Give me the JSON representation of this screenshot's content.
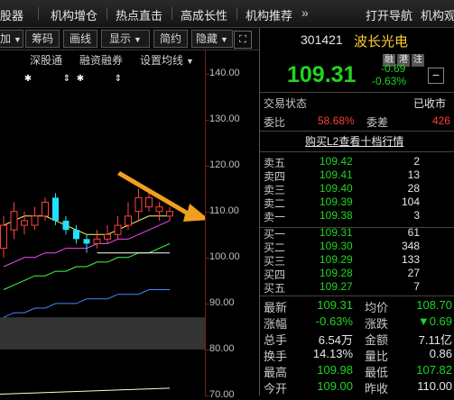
{
  "topbar": {
    "items": [
      "股器",
      "机构增仓",
      "热点直击",
      "高成长性",
      "机构推荐",
      "打开导航",
      "机构观点"
    ],
    "more_icon": "double-chevron-right-icon"
  },
  "toolbar": {
    "buttons": [
      "加",
      "筹码",
      "画线",
      "显示",
      "简约",
      "隐藏"
    ],
    "expand_icon": "expand-icon"
  },
  "chart": {
    "menus": [
      "深股通",
      "融资融券",
      "设置均线"
    ],
    "y_ticks": [
      "140.00",
      "130.00",
      "120.00",
      "110.00",
      "100.00",
      "90.00",
      "80.00",
      "70.00"
    ]
  },
  "chart_data": {
    "type": "candlestick",
    "title": "",
    "y_ticks": [
      140,
      130,
      120,
      110,
      100,
      90,
      80,
      70
    ],
    "ylim": [
      70,
      145
    ],
    "candles": [
      {
        "open": 102,
        "close": 107,
        "high": 109,
        "low": 100,
        "color": "red"
      },
      {
        "open": 106,
        "close": 110,
        "high": 112,
        "low": 104,
        "color": "red"
      },
      {
        "open": 108,
        "close": 107,
        "high": 110,
        "low": 105,
        "color": "red"
      },
      {
        "open": 107,
        "close": 109,
        "high": 111,
        "low": 106,
        "color": "red"
      },
      {
        "open": 109,
        "close": 112,
        "high": 113,
        "low": 108,
        "color": "red"
      },
      {
        "open": 113,
        "close": 108,
        "high": 114,
        "low": 107,
        "color": "cyan"
      },
      {
        "open": 108,
        "close": 106,
        "high": 109,
        "low": 105,
        "color": "cyan"
      },
      {
        "open": 106,
        "close": 104,
        "high": 107,
        "low": 103,
        "color": "cyan"
      },
      {
        "open": 104,
        "close": 103,
        "high": 105,
        "low": 101,
        "color": "cyan"
      },
      {
        "open": 103,
        "close": 104,
        "high": 106,
        "low": 102,
        "color": "red"
      },
      {
        "open": 104,
        "close": 105,
        "high": 107,
        "low": 103,
        "color": "red"
      },
      {
        "open": 105,
        "close": 107,
        "high": 109,
        "low": 104,
        "color": "red"
      },
      {
        "open": 107,
        "close": 109,
        "high": 112,
        "low": 106,
        "color": "red"
      },
      {
        "open": 110,
        "close": 113,
        "high": 115,
        "low": 108,
        "color": "red"
      },
      {
        "open": 113,
        "close": 111,
        "high": 114,
        "low": 110,
        "color": "red"
      },
      {
        "open": 111,
        "close": 110,
        "high": 112,
        "low": 108,
        "color": "red"
      },
      {
        "open": 110,
        "close": 109,
        "high": 111,
        "low": 108,
        "color": "red"
      }
    ],
    "moving_averages": [
      {
        "color": "#ffff66",
        "values": [
          107,
          108,
          109,
          109,
          109,
          108,
          107,
          106,
          105,
          105,
          105,
          106,
          107,
          108,
          109,
          109,
          109
        ]
      },
      {
        "color": "#ff44ff",
        "values": [
          98,
          99,
          100,
          100,
          101,
          101,
          102,
          102,
          102,
          103,
          103,
          104,
          104,
          105,
          106,
          107,
          108
        ]
      },
      {
        "color": "#44ff44",
        "values": [
          93,
          94,
          95,
          96,
          96,
          97,
          97,
          98,
          98,
          99,
          99,
          100,
          100,
          101,
          101,
          102,
          103
        ]
      },
      {
        "color": "#4488ff",
        "values": [
          87,
          88,
          88,
          89,
          89,
          90,
          90,
          90,
          91,
          91,
          91,
          92,
          92,
          92,
          93,
          93,
          93
        ]
      },
      {
        "color": "#ffffff",
        "values": [
          null,
          null,
          null,
          null,
          null,
          null,
          null,
          null,
          null,
          101,
          101,
          101,
          101,
          101,
          101,
          101,
          101
        ]
      }
    ]
  },
  "quote": {
    "code": "301421",
    "name": "波长光电",
    "tags": [
      "融",
      "港",
      "注"
    ],
    "price": "109.31",
    "change": "-0.69",
    "change_pct": "-0.63%",
    "minus_icon": "minus-icon",
    "status_label": "交易状态",
    "status_value": "已收市",
    "weibi_label": "委比",
    "weibi_value": "58.68%",
    "weicha_label": "委差",
    "weicha_value": "426",
    "l2_link": "购买L2查看十档行情"
  },
  "asks": [
    {
      "label": "卖五",
      "price": "109.42",
      "vol": "2"
    },
    {
      "label": "卖四",
      "price": "109.41",
      "vol": "13"
    },
    {
      "label": "卖三",
      "price": "109.40",
      "vol": "28"
    },
    {
      "label": "卖二",
      "price": "109.39",
      "vol": "104"
    },
    {
      "label": "卖一",
      "price": "109.38",
      "vol": "3"
    }
  ],
  "bids": [
    {
      "label": "买一",
      "price": "109.31",
      "vol": "61"
    },
    {
      "label": "买二",
      "price": "109.30",
      "vol": "348"
    },
    {
      "label": "买三",
      "price": "109.29",
      "vol": "133"
    },
    {
      "label": "买四",
      "price": "109.28",
      "vol": "27"
    },
    {
      "label": "买五",
      "price": "109.27",
      "vol": "7"
    }
  ],
  "stats": [
    {
      "l1": "最新",
      "v1": "109.31",
      "c1": "green",
      "l2": "均价",
      "v2": "108.70",
      "c2": "green"
    },
    {
      "l1": "涨幅",
      "v1": "-0.63%",
      "c1": "green",
      "l2": "涨跌",
      "v2": "▼0.69",
      "c2": "green"
    },
    {
      "l1": "总手",
      "v1": "6.54万",
      "c1": "white",
      "l2": "金额",
      "v2": "7.11亿",
      "c2": "white"
    },
    {
      "l1": "换手",
      "v1": "14.13%",
      "c1": "white",
      "l2": "量比",
      "v2": "0.86",
      "c2": "white"
    },
    {
      "l1": "最高",
      "v1": "109.98",
      "c1": "green",
      "l2": "最低",
      "v2": "107.82",
      "c2": "green"
    },
    {
      "l1": "今开",
      "v1": "109.00",
      "c1": "green",
      "l2": "昨收",
      "v2": "110.00",
      "c2": "white"
    }
  ]
}
